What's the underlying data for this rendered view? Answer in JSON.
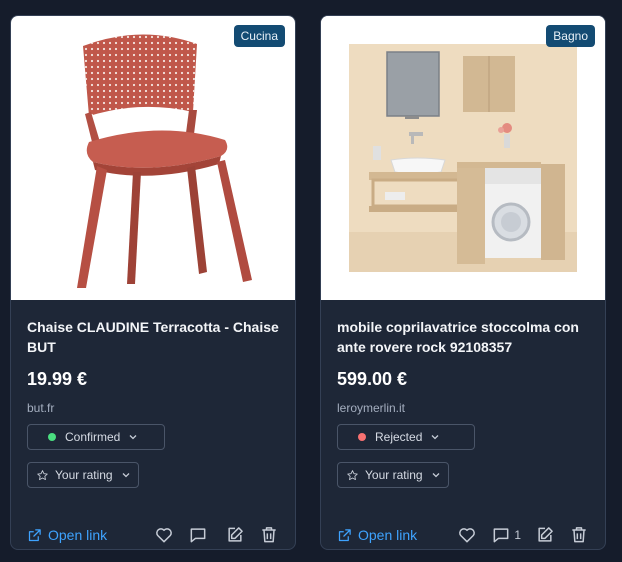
{
  "cards": [
    {
      "category": "Cucina",
      "title": "Chaise CLAUDINE Terracotta - Chaise BUT",
      "price": "19.99 €",
      "domain": "but.fr",
      "status": {
        "label": "Confirmed",
        "color": "#4ade80"
      },
      "rating_label": "Your rating",
      "open_link_label": "Open link",
      "comment_count": "",
      "image_desc": "chair-terracotta"
    },
    {
      "category": "Bagno",
      "title": "mobile coprilavatrice stoccolma con ante rovere rock 92108357",
      "price": "599.00 €",
      "domain": "leroymerlin.it",
      "status": {
        "label": "Rejected",
        "color": "#f87171"
      },
      "rating_label": "Your rating",
      "open_link_label": "Open link",
      "comment_count": "1",
      "image_desc": "bathroom-washer-cabinet"
    }
  ],
  "colors": {
    "accent": "#3ea3ff",
    "badge": "#134b73",
    "card": "#1e2737",
    "page": "#151c2b"
  }
}
